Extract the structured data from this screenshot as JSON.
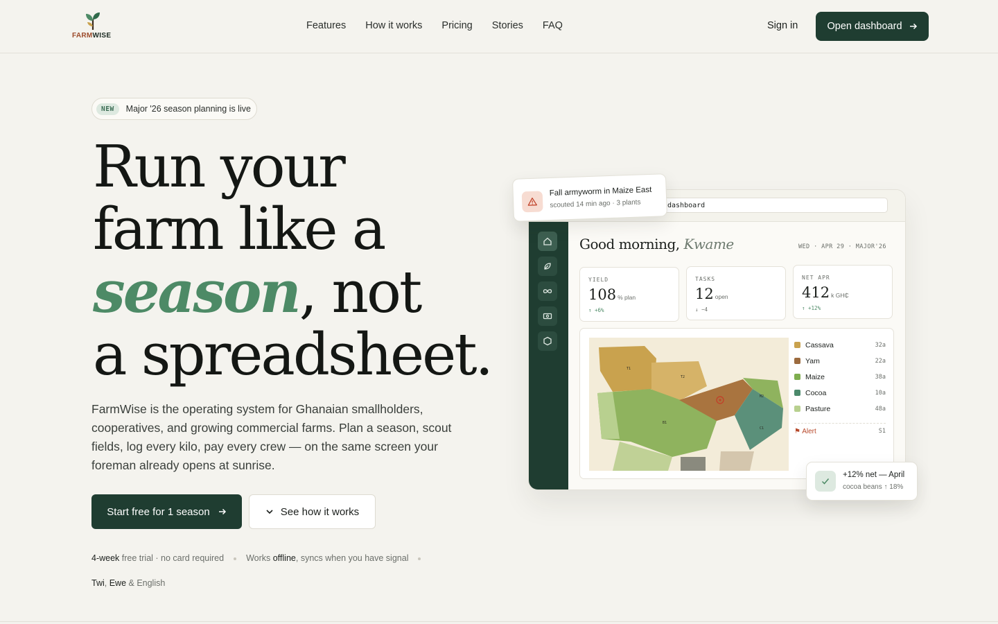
{
  "brand": {
    "name_part1": "FARM",
    "name_part2": "WISE"
  },
  "nav": {
    "links": [
      "Features",
      "How it works",
      "Pricing",
      "Stories",
      "FAQ"
    ],
    "sign_in": "Sign in",
    "open_dashboard": "Open dashboard"
  },
  "pill": {
    "badge": "NEW",
    "text": "Major '26 season planning is live"
  },
  "hero": {
    "line1": "Run your",
    "line2": "farm like a",
    "accent": "season",
    "line3_rest": ", not",
    "line4": "a spreadsheet.",
    "lede": "FarmWise is the operating system for Ghanaian smallholders, cooperatives, and growing commercial farms. Plan a season, scout fields, log every kilo, pay every crew — on the same screen your foreman already opens at sunrise.",
    "cta_primary": "Start free for 1 season",
    "cta_secondary": "See how it works"
  },
  "meta": {
    "trial_b": "4-week",
    "trial_rest": " free trial · no card required",
    "offline_pre": "Works ",
    "offline_b": "offline",
    "offline_rest": ", syncs when you have signal",
    "lang_b1": "Twi",
    "lang_sep1": ", ",
    "lang_b2": "Ewe",
    "lang_rest": " & English"
  },
  "dashboard": {
    "url": "dashboard",
    "greeting": "Good morning, ",
    "greeting_name": "Kwame",
    "date": "WED · APR 29 · MAJOR'26",
    "kpis": [
      {
        "label": "YIELD",
        "value": "108",
        "unit": "% plan",
        "delta": "↑ +6%"
      },
      {
        "label": "TASKS",
        "value": "12",
        "unit": "open",
        "delta": "↓ −4"
      },
      {
        "label": "NET APR",
        "value": "412",
        "unit": "k GH₵",
        "delta": "↑ +12%"
      }
    ],
    "fields": [
      "T1",
      "T2",
      "B1",
      "M2",
      "C1"
    ],
    "legend": [
      {
        "name": "Cassava",
        "value": "32a",
        "color": "#c9a24e"
      },
      {
        "name": "Yam",
        "value": "22a",
        "color": "#9c6b3e"
      },
      {
        "name": "Maize",
        "value": "38a",
        "color": "#7fae4f"
      },
      {
        "name": "Cocoa",
        "value": "10a",
        "color": "#4c8a6c"
      },
      {
        "name": "Pasture",
        "value": "48a",
        "color": "#b8d08f"
      }
    ],
    "alert_label": "⚑ Alert",
    "alert_value": "S1"
  },
  "alert_card": {
    "title": "Fall armyworm in Maize East",
    "subtitle": "scouted 14 min ago · 3 plants"
  },
  "ok_card": {
    "title": "+12% net — April",
    "subtitle": "cocoa beans ↑ 18%"
  },
  "colors": {
    "primary": "#1f3d31",
    "accent": "#4d8a66",
    "background": "#f4f3ee",
    "alert": "#b7492b"
  }
}
